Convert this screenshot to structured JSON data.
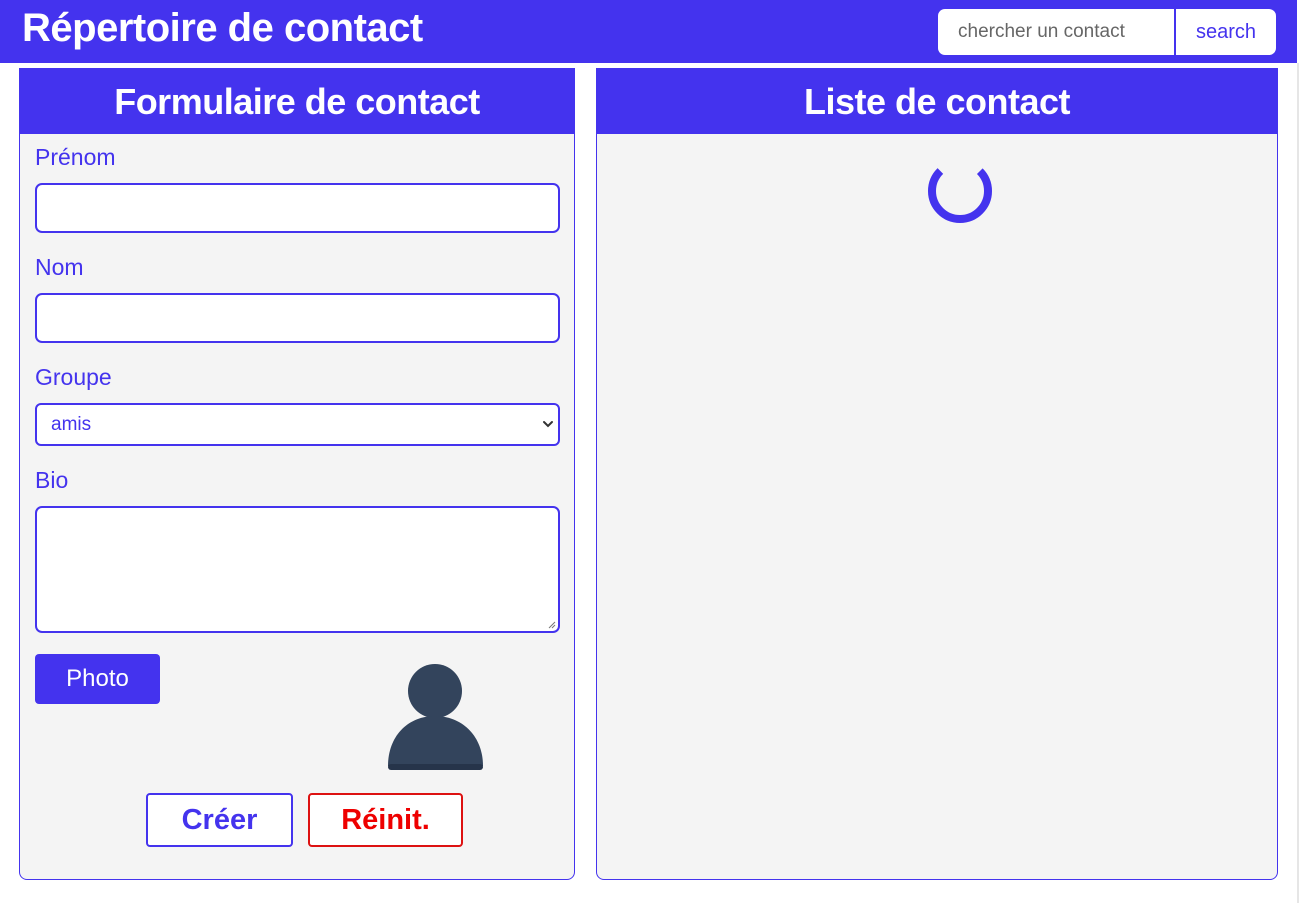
{
  "header": {
    "title": "Répertoire de contact",
    "search_placeholder": "chercher un contact",
    "search_value": "",
    "search_button": "search"
  },
  "form_panel": {
    "title": "Formulaire de contact",
    "fields": {
      "first_name": {
        "label": "Prénom",
        "value": ""
      },
      "last_name": {
        "label": "Nom",
        "value": ""
      },
      "group": {
        "label": "Groupe",
        "selected": "amis"
      },
      "bio": {
        "label": "Bio",
        "value": ""
      }
    },
    "photo_button": "Photo",
    "avatar_icon": "user-silhouette-icon",
    "create_button": "Créer",
    "reset_button": "Réinit."
  },
  "list_panel": {
    "title": "Liste de contact",
    "loading_icon": "spinner-icon"
  },
  "colors": {
    "accent": "#4433ee",
    "panel_bg": "#f4f4f4",
    "reset": "#ee0000",
    "avatar": "#33445c"
  }
}
